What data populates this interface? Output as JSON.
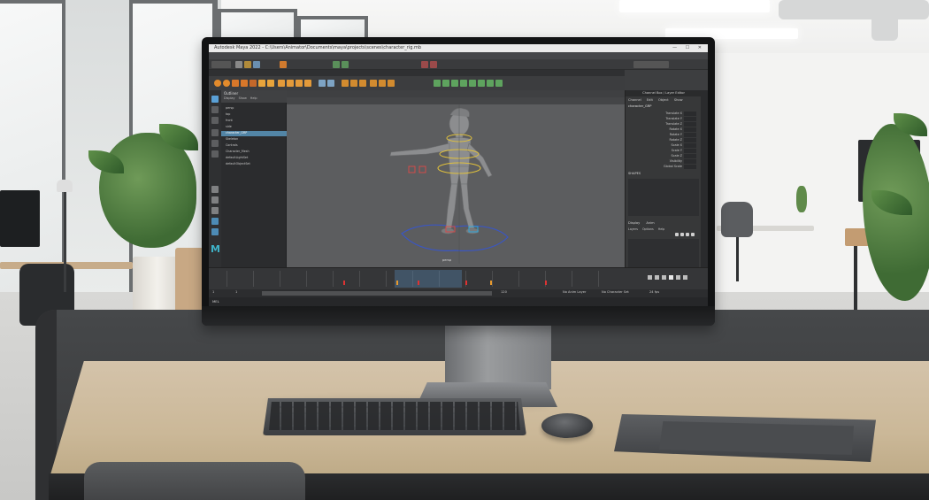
{
  "maya": {
    "title": "Autodesk Maya 2022 - C:\\Users\\Animator\\Documents\\maya\\projects\\scenes\\character_rig.mb",
    "window_controls": "— ☐ ✕",
    "menus": [
      "File",
      "Edit",
      "Create",
      "Select",
      "Modify",
      "Display",
      "Windows",
      "Mesh",
      "Edit Mesh",
      "Mesh Tools",
      "Mesh Display",
      "Curves",
      "Surfaces",
      "Deform",
      "UV",
      "Generate",
      "Cache",
      "Arnold",
      "Help"
    ],
    "shelf_tabs": [
      "Curves / Surfaces",
      "Poly Modeling",
      "Sculpting",
      "Rigging",
      "Animation",
      "Rendering",
      "FX",
      "FX Caching",
      "Custom",
      "Arnold",
      "Bifrost",
      "MASH"
    ],
    "outliner": {
      "title": "Outliner",
      "menu": "Display Show Help",
      "items": [
        "persp",
        "top",
        "front",
        "side",
        "character_GRP",
        "Skeleton",
        "Controls",
        "Character_Mesh",
        "defaultLightSet",
        "defaultObjectSet"
      ]
    },
    "viewport": {
      "menu": [
        "View",
        "Shading",
        "Lighting",
        "Show",
        "Renderer",
        "Panels"
      ],
      "camera_label": "persp"
    },
    "channel_box": {
      "title": "Channel Box / Layer Editor",
      "menu": "Channel Edit Object Show",
      "object": "character_GRP",
      "attributes": [
        "Translate X",
        "Translate Y",
        "Translate Z",
        "Rotate X",
        "Rotate Y",
        "Rotate Z",
        "Scale X",
        "Scale Y",
        "Scale Z",
        "Visibility",
        "Global Scale"
      ],
      "shapes_label": "SHAPES",
      "layer_tabs": "Display Anim",
      "layer_menu": "Layers Options Help"
    },
    "range": {
      "start": "1",
      "end": "120",
      "current": "1",
      "anim_layer": "No Anim Layer",
      "char_set": "No Character Set",
      "fps": "24 fps"
    },
    "cmd_label": "MEL",
    "logo": "M"
  }
}
